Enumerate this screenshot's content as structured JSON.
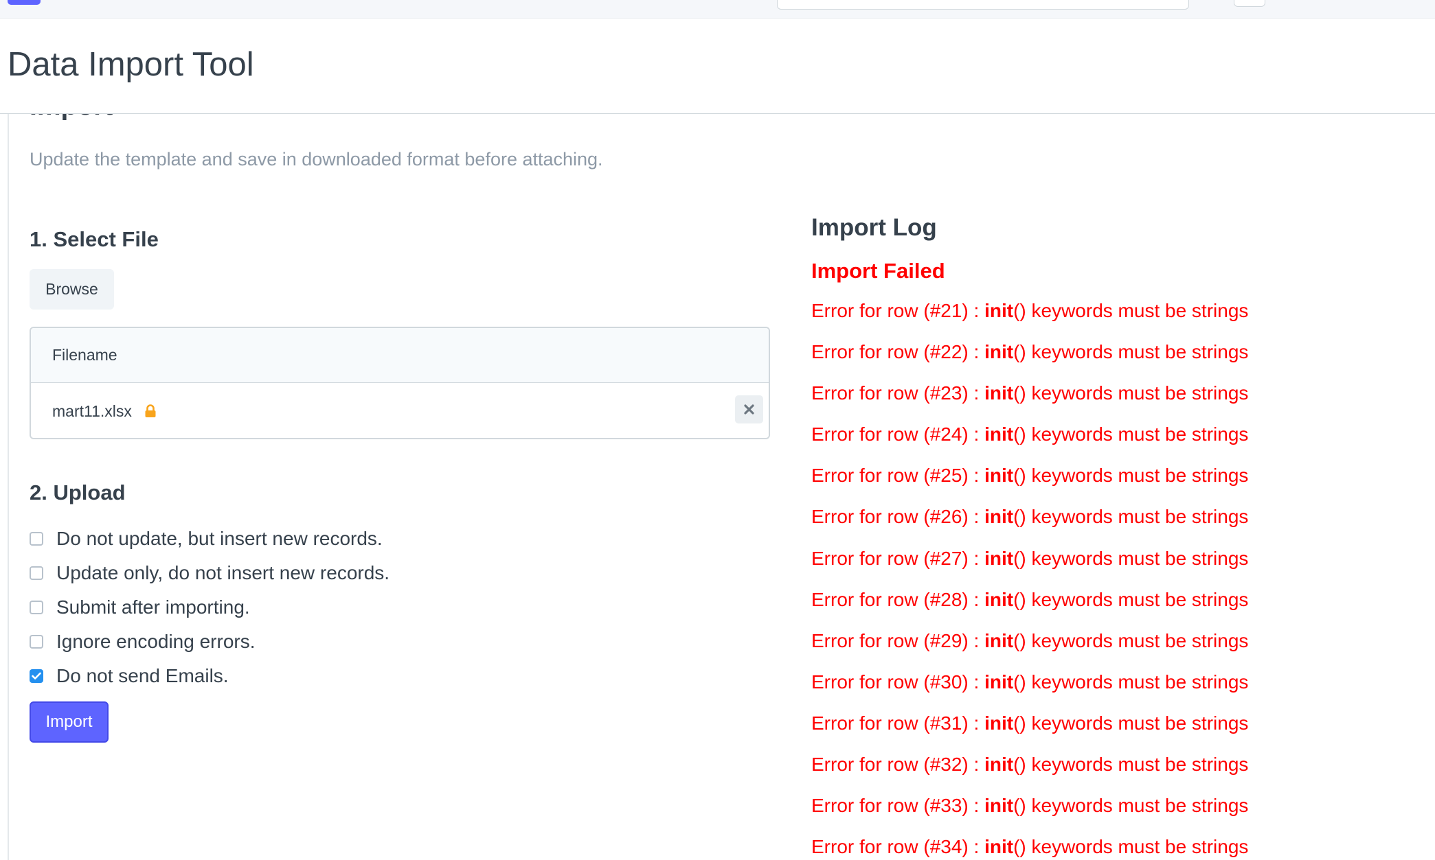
{
  "page_title": "Data Import Tool",
  "section_title": "Import",
  "description": "Update the template and save in downloaded format before attaching.",
  "step1": {
    "title": "1. Select File",
    "browse_label": "Browse",
    "table_header": "Filename",
    "file_name": "mart11.xlsx"
  },
  "step2": {
    "title": "2. Upload",
    "options": [
      {
        "label": "Do not update, but insert new records.",
        "checked": false
      },
      {
        "label": "Update only, do not insert new records.",
        "checked": false
      },
      {
        "label": "Submit after importing.",
        "checked": false
      },
      {
        "label": "Ignore encoding errors.",
        "checked": false
      },
      {
        "label": "Do not send Emails.",
        "checked": true
      }
    ],
    "import_label": "Import"
  },
  "log": {
    "title": "Import Log",
    "status": "Import Failed",
    "keyword": "init",
    "error_prefix": "Error for row",
    "error_suffix": "() keywords must be strings",
    "rows": [
      "#21",
      "#22",
      "#23",
      "#24",
      "#25",
      "#26",
      "#27",
      "#28",
      "#29",
      "#30",
      "#31",
      "#32",
      "#33",
      "#34"
    ]
  },
  "colors": {
    "accent": "#5e64ff",
    "error": "#ff0000",
    "checkbox_checked": "#2490ef",
    "warning_icon": "#f8a41c"
  },
  "icons": {
    "lock": "lock-icon",
    "remove": "close-icon",
    "check": "check-icon"
  }
}
